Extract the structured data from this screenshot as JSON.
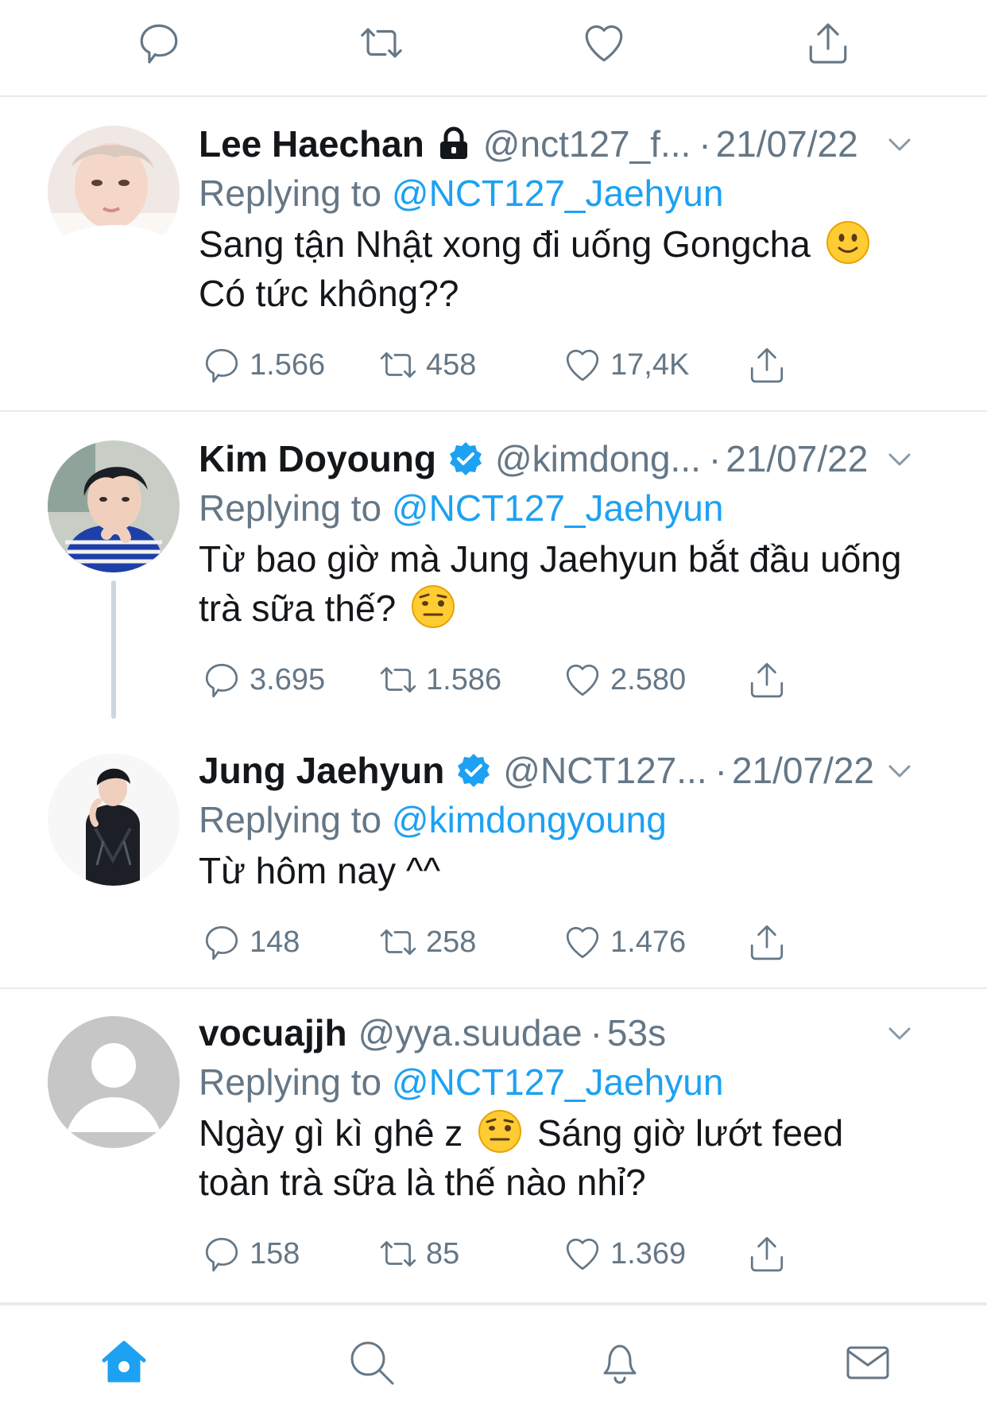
{
  "top_actions": {
    "reply_icon": "reply-icon",
    "retweet_icon": "retweet-icon",
    "like_icon": "like-icon",
    "share_icon": "share-icon"
  },
  "tweets": [
    {
      "name": "Lee Haechan",
      "badge": "lock-icon",
      "handle": "@nct127_f...",
      "dot": "·",
      "time": "21/07/22",
      "reply_prefix": "Replying to",
      "reply_to": "@NCT127_Jaehyun",
      "text_line1": "Sang tận Nhật xong đi uống Gongcha",
      "text_line2": "Có tức không??",
      "emoji": "slightly-smiling-face",
      "replies": "1.566",
      "retweets": "458",
      "likes": "17,4K"
    },
    {
      "name": "Kim Doyoung",
      "badge": "verified-icon",
      "handle": "@kimdong...",
      "dot": "·",
      "time": "21/07/22",
      "reply_prefix": "Replying to",
      "reply_to": "@NCT127_Jaehyun",
      "text_line1": "Từ bao giờ mà Jung Jaehyun bắt đầu uống",
      "text_line2": "trà sữa thế?",
      "emoji": "face-with-raised-eyebrow",
      "replies": "3.695",
      "retweets": "1.586",
      "likes": "2.580"
    },
    {
      "name": "Jung Jaehyun",
      "badge": "verified-icon",
      "handle": "@NCT127...",
      "dot": "·",
      "time": "21/07/22",
      "reply_prefix": "Replying to",
      "reply_to": "@kimdongyoung",
      "text_line1": "Từ hôm nay ^^",
      "replies": "148",
      "retweets": "258",
      "likes": "1.476"
    },
    {
      "name": "vocuajjh",
      "handle": "@yya.suudae",
      "dot": "·",
      "time": "53s",
      "reply_prefix": "Replying to",
      "reply_to": "@NCT127_Jaehyun",
      "text_line1_a": "Ngày gì kì ghê z",
      "text_line1_b": "Sáng giờ lướt feed",
      "text_line2": "toàn trà sữa là thế nào nhỉ?",
      "emoji": "face-with-raised-eyebrow",
      "replies": "158",
      "retweets": "85",
      "likes": "1.369"
    }
  ],
  "tabbar": {
    "items": [
      "home-icon",
      "search-icon",
      "notifications-icon",
      "messages-icon"
    ],
    "active": "home-icon",
    "accent": "#1da1f2"
  },
  "colors": {
    "text": "#14171a",
    "secondary": "#657786",
    "link": "#1da1f2",
    "divider": "#e6ecf0",
    "thread_line": "#ccd6dd"
  }
}
